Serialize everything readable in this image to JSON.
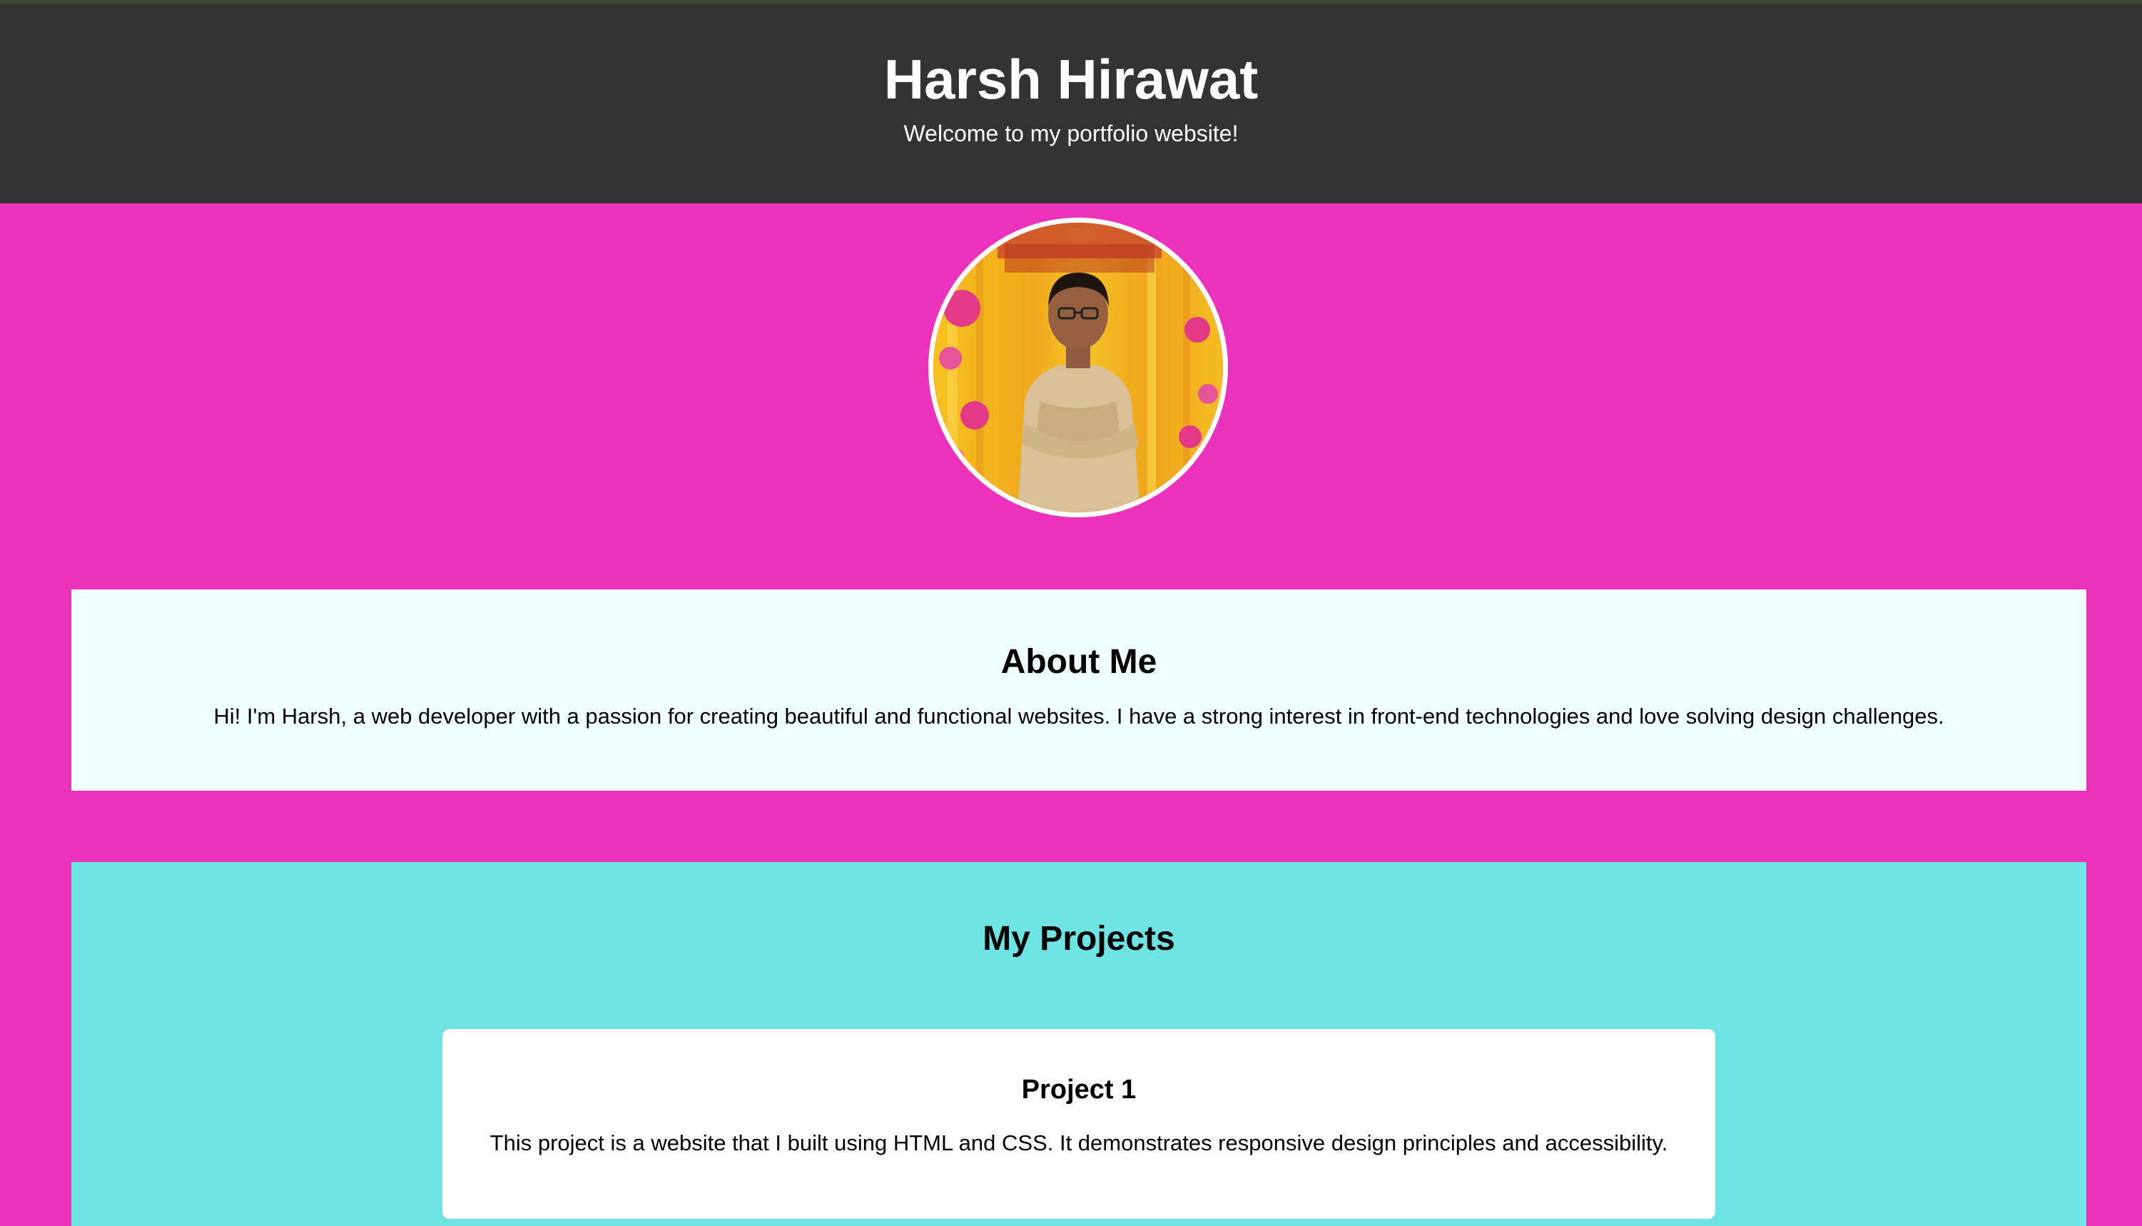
{
  "header": {
    "title": "Harsh Hirawat",
    "tagline": "Welcome to my portfolio website!"
  },
  "about": {
    "heading": "About Me",
    "text": "Hi! I'm Harsh, a web developer with a passion for creating beautiful and functional websites. I have a strong interest in front-end technologies and love solving design challenges."
  },
  "projects": {
    "heading": "My Projects",
    "items": [
      {
        "title": "Project 1",
        "description": "This project is a website that I built using HTML and CSS. It demonstrates responsive design principles and accessibility."
      }
    ]
  },
  "colors": {
    "header_bg": "#333333",
    "page_bg": "#ec31bc",
    "about_bg": "#f0ffff",
    "projects_bg": "#6ee3e3",
    "card_bg": "#ffffff"
  }
}
